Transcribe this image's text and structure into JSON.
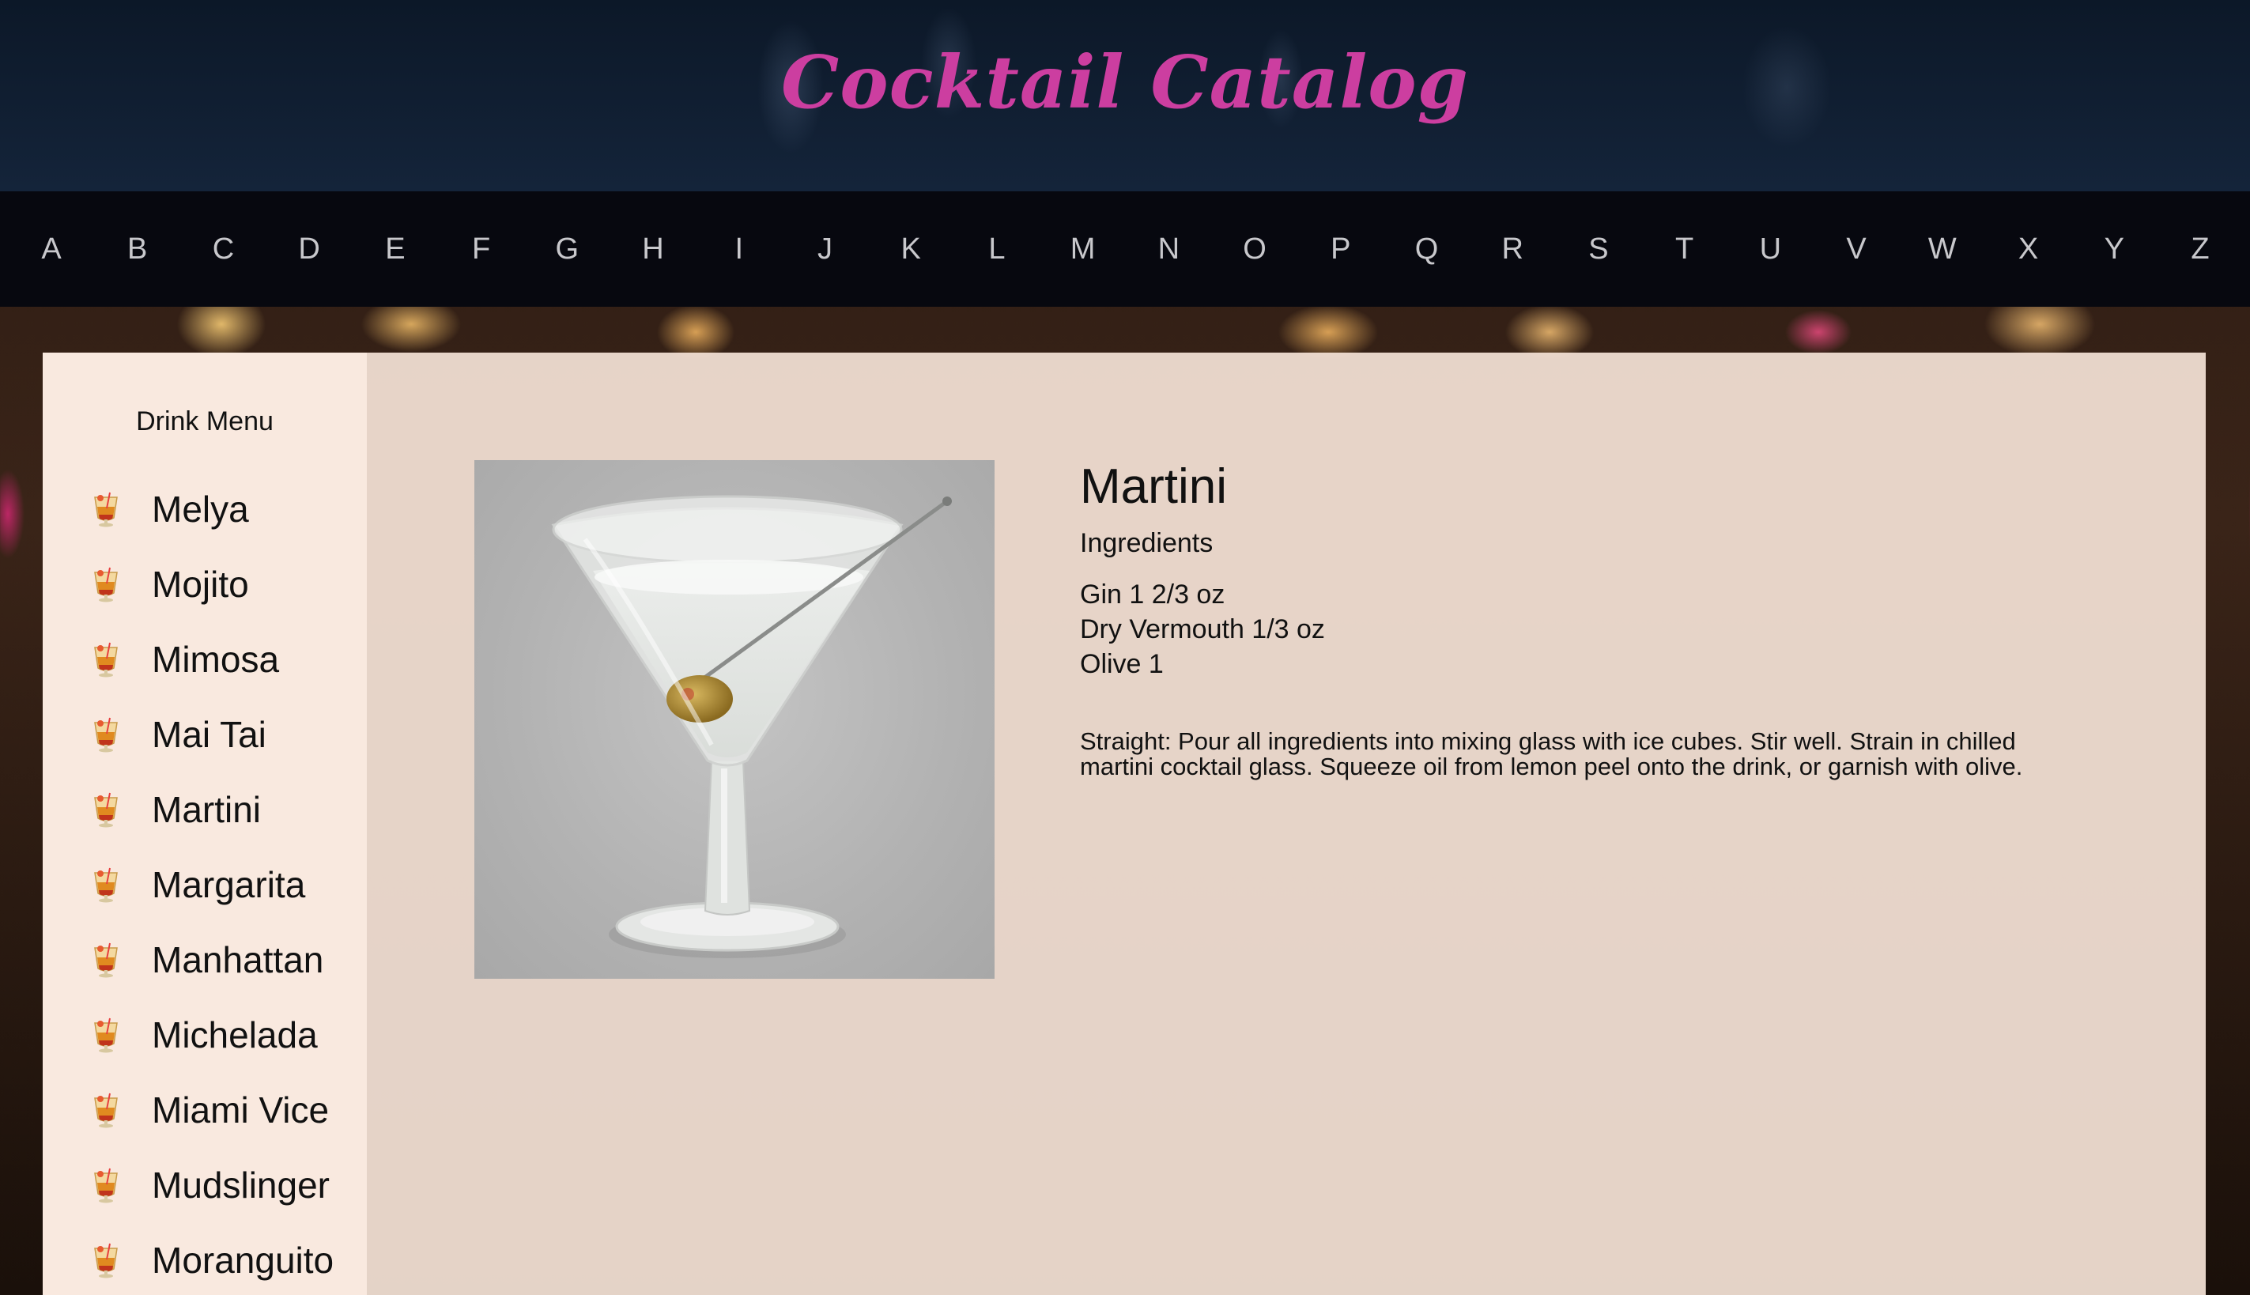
{
  "header": {
    "title": "Cocktail Catalog"
  },
  "alphabet": [
    "A",
    "B",
    "C",
    "D",
    "E",
    "F",
    "G",
    "H",
    "I",
    "J",
    "K",
    "L",
    "M",
    "N",
    "O",
    "P",
    "Q",
    "R",
    "S",
    "T",
    "U",
    "V",
    "W",
    "X",
    "Y",
    "Z"
  ],
  "sidebar": {
    "title": "Drink Menu",
    "items": [
      {
        "label": "Melya",
        "icon": "tropical-drink-icon"
      },
      {
        "label": "Mojito",
        "icon": "tropical-drink-icon"
      },
      {
        "label": "Mimosa",
        "icon": "tropical-drink-icon"
      },
      {
        "label": "Mai Tai",
        "icon": "tropical-drink-icon"
      },
      {
        "label": "Martini",
        "icon": "tropical-drink-icon"
      },
      {
        "label": "Margarita",
        "icon": "tropical-drink-icon"
      },
      {
        "label": "Manhattan",
        "icon": "tropical-drink-icon"
      },
      {
        "label": "Michelada",
        "icon": "tropical-drink-icon"
      },
      {
        "label": "Miami Vice",
        "icon": "tropical-drink-icon"
      },
      {
        "label": "Mudslinger",
        "icon": "tropical-drink-icon"
      },
      {
        "label": "Moranguito",
        "icon": "tropical-drink-icon"
      }
    ]
  },
  "drink": {
    "name": "Martini",
    "ingredients_heading": "Ingredients",
    "ingredients": [
      "Gin 1 2/3 oz",
      "Dry Vermouth 1/3 oz",
      "Olive 1"
    ],
    "instructions": "Straight: Pour all ingredients into mixing glass with ice cubes. Stir well. Strain in chilled martini cocktail glass. Squeeze oil from lemon peel onto the drink, or garnish with olive."
  },
  "colors": {
    "title": "#cc3ea0",
    "nav_bg": "#07080f",
    "panel_bg": "#f4e2d6"
  }
}
